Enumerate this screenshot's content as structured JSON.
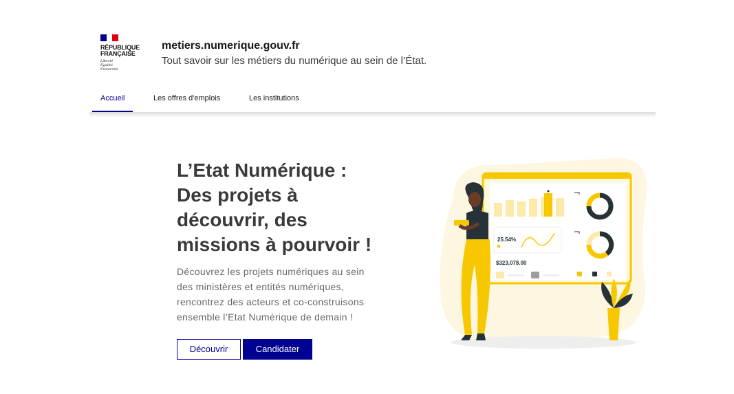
{
  "header": {
    "logo": {
      "title_line1": "RÉPUBLIQUE",
      "title_line2": "FRANÇAISE",
      "motto_line1": "Liberté",
      "motto_line2": "Égalité",
      "motto_line3": "Fraternité",
      "flag_colors": [
        "#000091",
        "#ffffff",
        "#e1000f"
      ]
    },
    "site_name": "metiers.numerique.gouv.fr",
    "tagline": "Tout savoir sur les métiers du numérique au sein de l’État."
  },
  "nav": {
    "items": [
      {
        "label": "Accueil",
        "active": true
      },
      {
        "label": "Les offres d'emplois",
        "active": false
      },
      {
        "label": "Les institutions",
        "active": false
      }
    ]
  },
  "hero": {
    "title_lines": [
      "L’Etat Numérique :",
      "Des projets à",
      "découvrir, des",
      "missions à pourvoir !"
    ],
    "text_lines": [
      "Découvrez les projets numériques au sein",
      "des ministères et entités numériques,",
      "rencontrez des acteurs et co-construisons",
      "ensemble l’Etat Numérique de demain !"
    ],
    "buttons": {
      "discover": "Découvrir",
      "apply": "Candidater"
    }
  },
  "illustration": {
    "percent_label": "25.54%",
    "amount_label": "$323,078.00",
    "colors": {
      "accent": "#f7c800",
      "dark": "#263238",
      "skin": "#6b3b2a"
    }
  }
}
